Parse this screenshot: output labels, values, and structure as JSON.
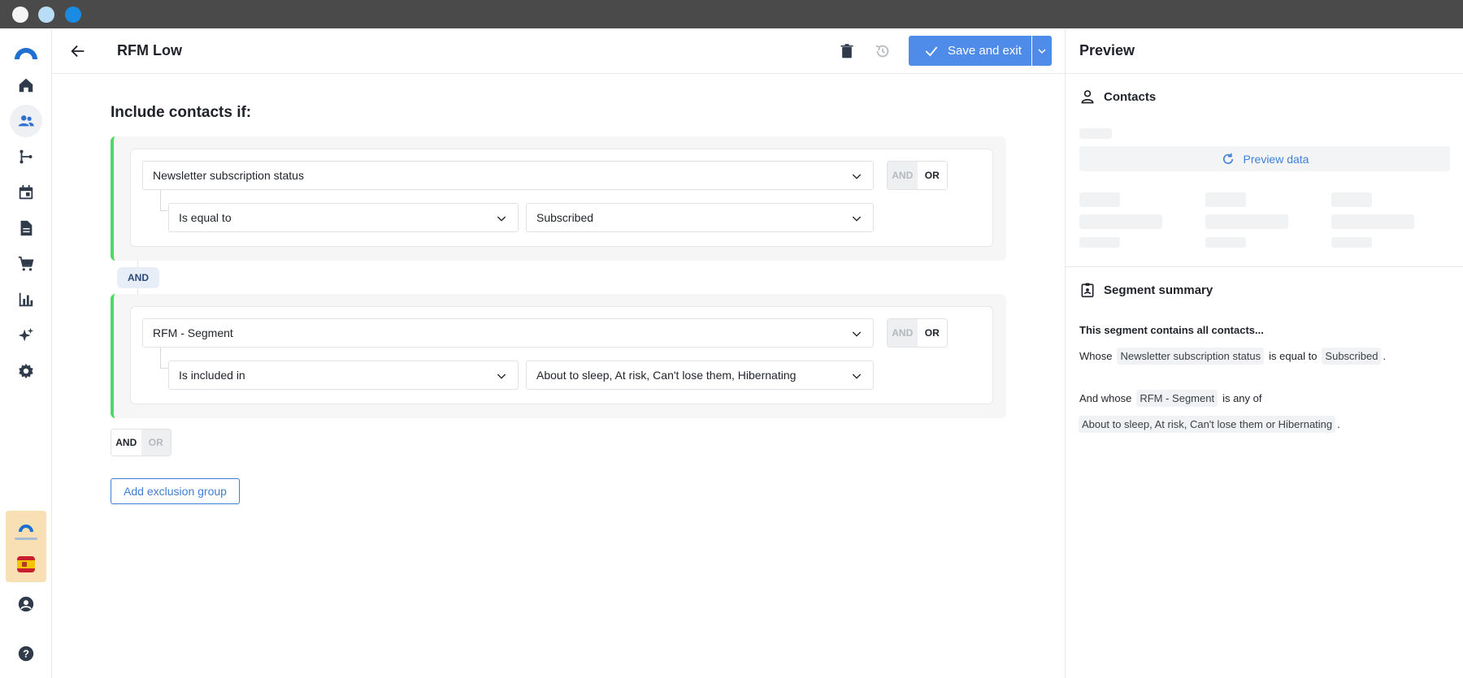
{
  "header": {
    "title": "RFM Low",
    "save_label": "Save and exit"
  },
  "builder": {
    "include_title": "Include contacts if:",
    "groups": [
      {
        "field": "Newsletter subscription status",
        "operator": "Is equal to",
        "value": "Subscribed",
        "and_label": "AND",
        "or_label": "OR"
      },
      {
        "field": "RFM - Segment",
        "operator": "Is included in",
        "value": "About to sleep, At risk, Can't lose them, Hibernating",
        "and_label": "AND",
        "or_label": "OR"
      }
    ],
    "between_label": "AND",
    "bottom_toggle": {
      "and_label": "AND",
      "or_label": "OR"
    },
    "add_exclusion_label": "Add exclusion group"
  },
  "preview": {
    "title": "Preview",
    "contacts_label": "Contacts",
    "preview_data_label": "Preview data",
    "summary_title": "Segment summary",
    "summary_intro": "This segment contains all contacts...",
    "line1": {
      "prefix": "Whose",
      "field": "Newsletter subscription status",
      "op": "is equal to",
      "value": "Subscribed",
      "suffix": "."
    },
    "line2": {
      "prefix": "And whose",
      "field": "RFM - Segment",
      "op": "is any of"
    },
    "line3": {
      "value": "About to sleep, At risk, Can't lose them or Hibernating",
      "suffix": "."
    }
  },
  "colors": {
    "accent": "#4f8be8",
    "group_border": "#4cd964",
    "titlebar": "#4a4a4a"
  },
  "icons": {
    "sidebar": [
      "brand-logo-icon",
      "home-icon",
      "contacts-icon",
      "automation-icon",
      "calendar-icon",
      "document-icon",
      "cart-icon",
      "chart-icon",
      "sparkles-icon",
      "gear-icon",
      "user-circle-icon",
      "help-icon"
    ]
  }
}
